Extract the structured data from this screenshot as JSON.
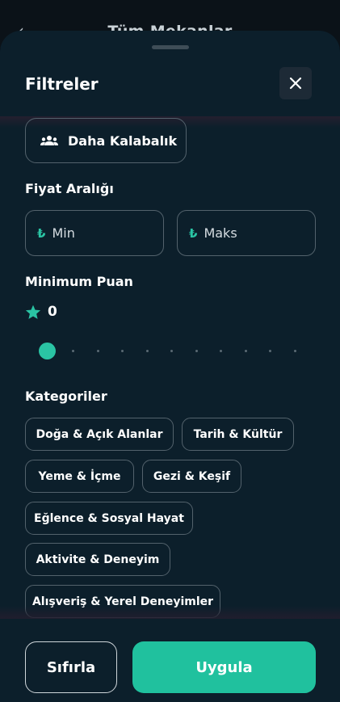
{
  "backdrop": {
    "title": "Tüm Mekanlar"
  },
  "sheet": {
    "title": "Filtreler",
    "crowd_option": "Daha Kalabalık",
    "price": {
      "title": "Fiyat Aralığı",
      "currency_symbol": "₺",
      "min_placeholder": "Min",
      "max_placeholder": "Maks"
    },
    "rating": {
      "title": "Minimum Puan",
      "value": "0",
      "slider_value": 0
    },
    "categories": {
      "title": "Kategoriler",
      "items": [
        "Doğa & Açık Alanlar",
        "Tarih & Kültür",
        "Yeme & İçme",
        "Gezi & Keşif",
        "Eğlence & Sosyal Hayat",
        "Aktivite & Deneyim",
        "Alışveriş & Yerel Deneyimler"
      ]
    },
    "footer": {
      "reset_label": "Sıfırla",
      "apply_label": "Uygula"
    }
  },
  "colors": {
    "accent": "#20c19e",
    "sheet_bg": "#0c1f2b",
    "border": "#53626c"
  },
  "icons": {
    "close": "close-icon",
    "crowd": "group-icon",
    "star": "star-icon",
    "back": "chevron-left-icon"
  }
}
